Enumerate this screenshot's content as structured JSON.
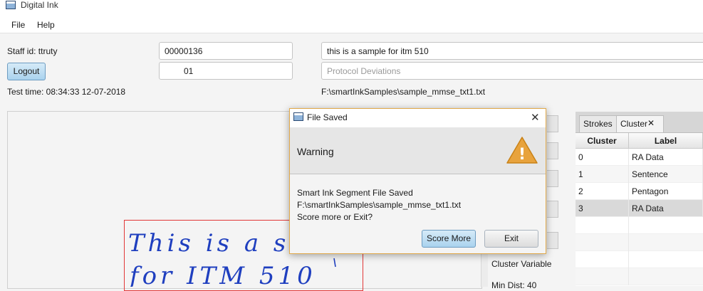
{
  "window": {
    "title": "Digital Ink"
  },
  "menu": {
    "file": "File",
    "help": "Help"
  },
  "staff": {
    "label": "Staff id: ttruty",
    "id_value": "00000136",
    "session_value": "01",
    "logout_label": "Logout"
  },
  "note": {
    "value": "this is a sample for itm 510",
    "protocol_placeholder": "Protocol Deviations"
  },
  "test_time": "Test time: 08:34:33 12-07-2018",
  "file_path": "F:\\smartInkSamples\\sample_mmse_txt1.txt",
  "ink_text": {
    "line1": "This is a s",
    "line2": "for ITM 510"
  },
  "side_labels": {
    "cluster_variable": "Cluster  Variable",
    "min_dist": "Min Dist: 40"
  },
  "tabs": [
    {
      "label": "Strokes"
    },
    {
      "label": "Cluster"
    }
  ],
  "tab_close_glyph": "✕",
  "table": {
    "headers": [
      "Cluster",
      "Label"
    ],
    "rows": [
      [
        "0",
        "RA Data"
      ],
      [
        "1",
        "Sentence"
      ],
      [
        "2",
        "Pentagon"
      ],
      [
        "3",
        "RA Data"
      ]
    ]
  },
  "dialog": {
    "title": "File Saved",
    "close_glyph": "✕",
    "header": "Warning",
    "warning_glyph": "!",
    "message_line1": "Smart Ink Segment File Saved",
    "message_line2": "F:\\smartInkSamples\\sample_mmse_txt1.txt",
    "message_line3": "Score more or Exit?",
    "score_more": "Score More",
    "exit": "Exit"
  },
  "colors": {
    "accent_blue": "#a9d2ee",
    "warning_orange": "#e8a33d",
    "ink_blue": "#1f3fbf",
    "selection_red": "#e23737"
  }
}
